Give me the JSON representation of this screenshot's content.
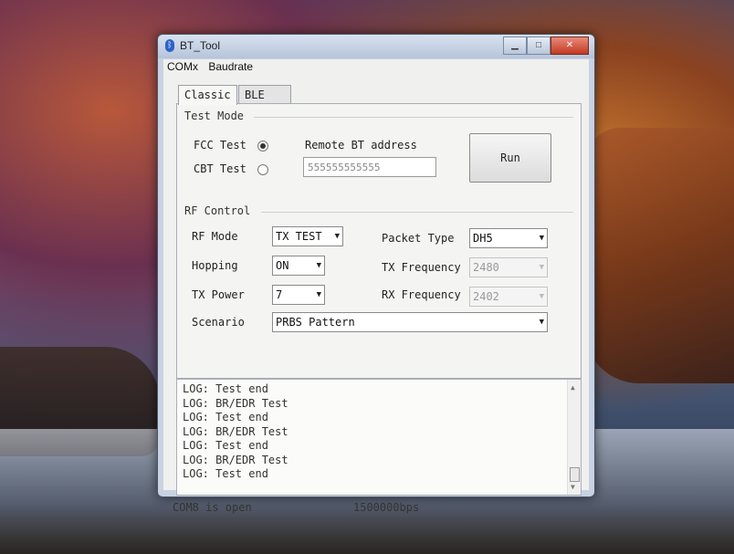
{
  "window": {
    "title": "BT_Tool",
    "buttons": {
      "minimize": "▁",
      "maximize": "□",
      "close": "✕"
    }
  },
  "menu": [
    "COMx",
    "Baudrate"
  ],
  "tabs": [
    "Classic",
    "BLE"
  ],
  "test_mode": {
    "label": "Test Mode",
    "fcc": "FCC Test",
    "cbt": "CBT Test",
    "selected": "FCC Test",
    "remote_label": "Remote BT address",
    "remote_value": "555555555555",
    "run": "Run"
  },
  "rf_control": {
    "label": "RF Control",
    "rf_mode_label": "RF Mode",
    "rf_mode": "TX TEST",
    "hopping_label": "Hopping",
    "hopping": "ON",
    "tx_power_label": "TX Power",
    "tx_power": "7",
    "scenario_label": "Scenario",
    "scenario": "PRBS Pattern",
    "packet_type_label": "Packet Type",
    "packet_type": "DH5",
    "tx_freq_label": "TX Frequency",
    "tx_freq": "2480",
    "rx_freq_label": "RX Frequency",
    "rx_freq": "2402"
  },
  "log": [
    "LOG: Test end",
    "LOG: BR/EDR Test",
    "LOG: Test end",
    "LOG: BR/EDR Test",
    "LOG: Test end",
    "LOG: BR/EDR Test",
    "LOG: Test end"
  ],
  "status": {
    "port": "COM8 is open",
    "baud": "1500000bps"
  }
}
